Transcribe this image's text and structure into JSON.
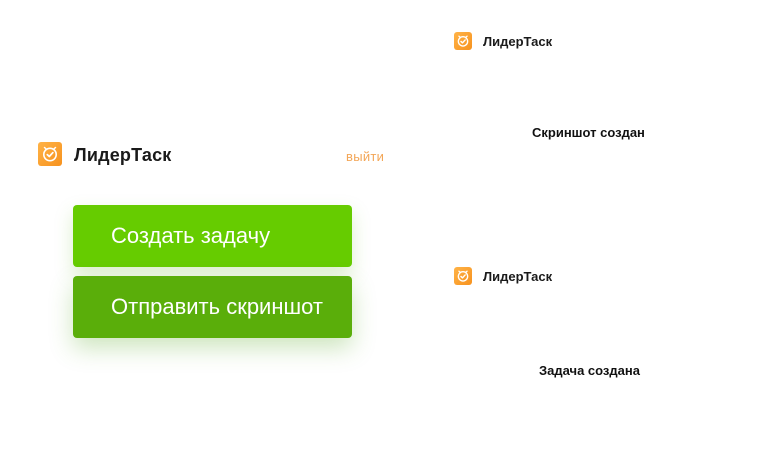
{
  "app": {
    "brand_name": "ЛидерТаск",
    "accent_color": "#f7921e",
    "logo_icon": "clock-check-icon"
  },
  "panel": {
    "logout_label": "выйти",
    "create_task_label": "Создать задачу",
    "send_screenshot_label": "Отправить скриншот",
    "create_color": "#66cc00",
    "send_color": "#5aae0a"
  },
  "notifications": [
    {
      "title": "ЛидерТаск",
      "message": "Скриншот создан"
    },
    {
      "title": "ЛидерТаск",
      "message": "Задача создана"
    }
  ]
}
